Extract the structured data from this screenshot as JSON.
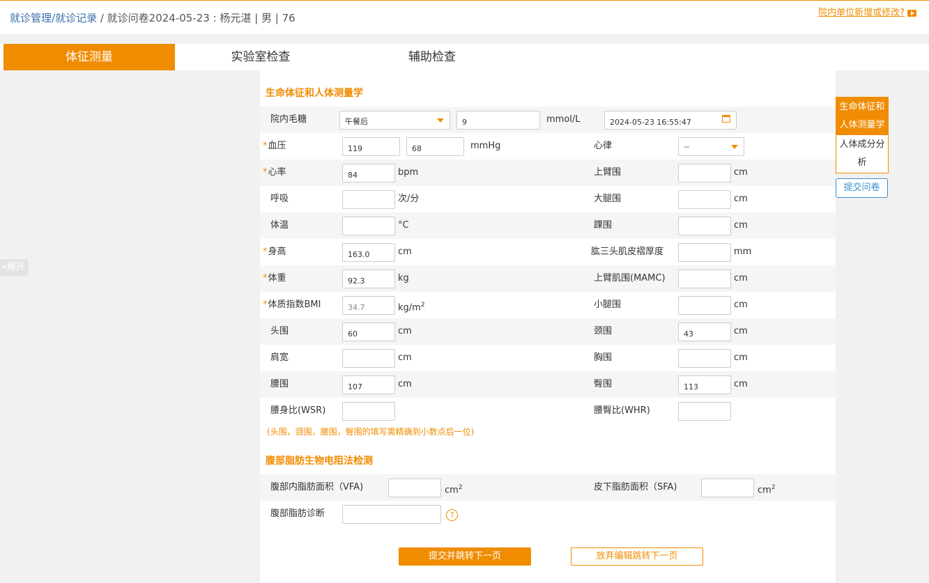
{
  "breadcrumb": {
    "item1": "就诊管理",
    "item2": "/就诊记录",
    "current": " / 就诊问卷2024-05-23 : 杨元湛 | 男 | 76"
  },
  "top_link": "院内单位新增或修改?",
  "tabs": [
    "体征测量",
    "实验室检查",
    "辅助检查"
  ],
  "expand_label": "展开",
  "section1_title": "生命体征和人体测量学",
  "glucose": {
    "label": "院内毛糖",
    "select": "午餐后",
    "value": "9",
    "unit": "mmol/L",
    "datetime": "2024-05-23 16:55:47"
  },
  "left_fields": [
    {
      "label": "血压",
      "required": "*",
      "value": "119",
      "value2": "68",
      "unit": "mmHg"
    },
    {
      "label": "心率",
      "required": "*",
      "value": "84",
      "unit": "bpm"
    },
    {
      "label": "呼吸",
      "required": "",
      "value": "",
      "unit": "次/分"
    },
    {
      "label": "体温",
      "required": "",
      "value": "",
      "unit": "°C"
    },
    {
      "label": "身高",
      "required": "*",
      "value": "163.0",
      "unit": "cm"
    },
    {
      "label": "体重",
      "required": "*",
      "value": "92.3",
      "unit": "kg"
    },
    {
      "label": "体质指数BMI",
      "required": "*",
      "value": "34.7",
      "unit": "kg/m",
      "unit_sup": "2"
    },
    {
      "label": "头围",
      "required": "",
      "value": "60",
      "unit": "cm"
    },
    {
      "label": "肩宽",
      "required": "",
      "value": "",
      "unit": "cm"
    },
    {
      "label": "腰围",
      "required": "",
      "value": "107",
      "unit": "cm"
    },
    {
      "label": "腰身比(WSR)",
      "required": "",
      "value": "",
      "unit": ""
    }
  ],
  "right_fields": [
    {
      "label": "心律",
      "value": "--",
      "unit": ""
    },
    {
      "label": "上臂围",
      "value": "",
      "unit": "cm"
    },
    {
      "label": "大腿围",
      "value": "",
      "unit": "cm"
    },
    {
      "label": "踝围",
      "value": "",
      "unit": "cm"
    },
    {
      "label": "肱三头肌皮褶厚度",
      "value": "",
      "unit": "mm"
    },
    {
      "label": "上臂肌围(MAMC)",
      "value": "",
      "unit": "cm"
    },
    {
      "label": "小腿围",
      "value": "",
      "unit": "cm"
    },
    {
      "label": "颈围",
      "value": "43",
      "unit": "cm"
    },
    {
      "label": "胸围",
      "value": "",
      "unit": "cm"
    },
    {
      "label": "臀围",
      "value": "113",
      "unit": "cm"
    },
    {
      "label": "腰臀比(WHR)",
      "value": "",
      "unit": ""
    }
  ],
  "note": "(头围，颈围，腰围，臀围的填写需精确到小数点后一位)",
  "section2_title": "腹部脂肪生物电阻法检测",
  "vfa": {
    "label": "腹部内脂肪面积（VFA)",
    "value": "",
    "unit": "cm",
    "unit_sup": "2"
  },
  "sfa": {
    "label": "皮下脂肪面积（SFA)",
    "value": "",
    "unit": "cm",
    "unit_sup": "2"
  },
  "diagnosis": {
    "label": "腹部脂肪诊断",
    "value": "",
    "help": "?"
  },
  "buttons": {
    "submit_next": "提交并跳转下一页",
    "discard_next": "放弃编辑跳转下一页"
  },
  "sidenav": [
    "生命体征和人体测量学",
    "人体成分分析"
  ],
  "submit_questionnaire": "提交问卷",
  "colors": {
    "accent": "#f08c00",
    "link": "#3a6fa8",
    "shade": "#f5f5f5"
  }
}
